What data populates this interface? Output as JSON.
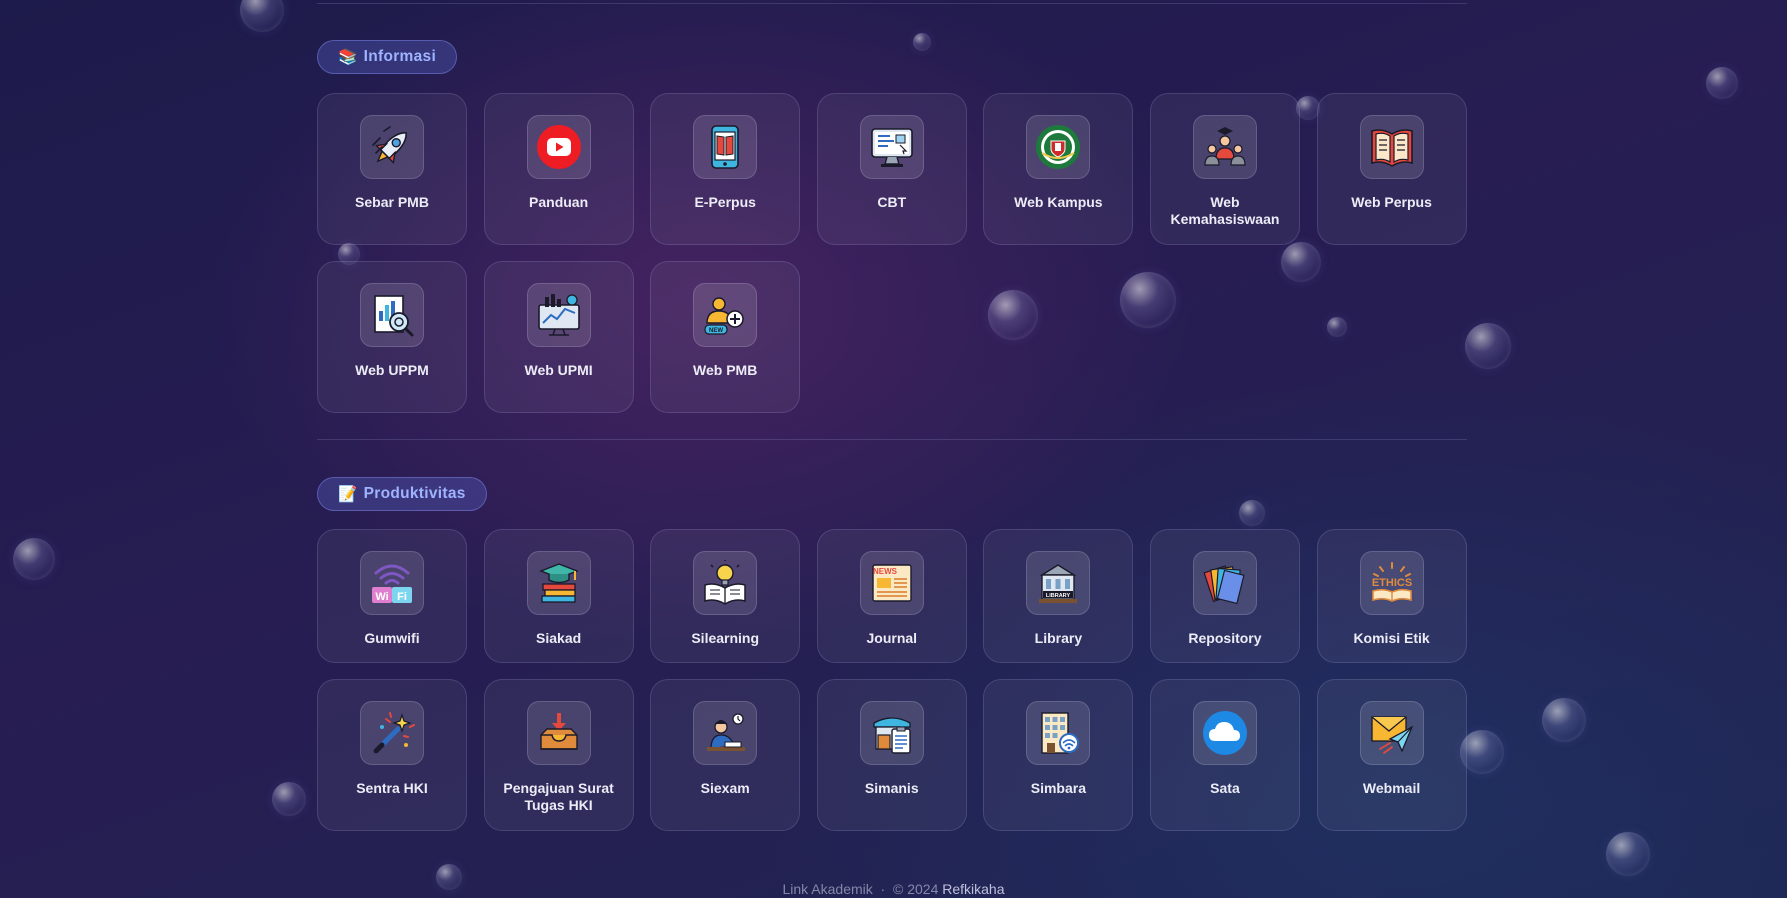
{
  "sections": [
    {
      "emoji": "📚",
      "title": "Informasi",
      "items": [
        {
          "label": "Sebar PMB",
          "icon": "rocket-icon"
        },
        {
          "label": "Panduan",
          "icon": "youtube-icon"
        },
        {
          "label": "E-Perpus",
          "icon": "ebook-icon"
        },
        {
          "label": "CBT",
          "icon": "computer-test-icon"
        },
        {
          "label": "Web Kampus",
          "icon": "campus-logo-icon"
        },
        {
          "label": "Web Kemahasiswaan",
          "icon": "students-icon"
        },
        {
          "label": "Web Perpus",
          "icon": "open-book-icon"
        },
        {
          "label": "Web UPPM",
          "icon": "research-icon"
        },
        {
          "label": "Web UPMI",
          "icon": "monitor-chart-icon"
        },
        {
          "label": "Web PMB",
          "icon": "new-user-icon"
        }
      ]
    },
    {
      "emoji": "📝",
      "title": "Produktivitas",
      "items": [
        {
          "label": "Gumwifi",
          "icon": "wifi-icon"
        },
        {
          "label": "Siakad",
          "icon": "graduation-books-icon"
        },
        {
          "label": "Silearning",
          "icon": "lightbulb-book-icon"
        },
        {
          "label": "Journal",
          "icon": "newspaper-icon"
        },
        {
          "label": "Library",
          "icon": "library-building-icon"
        },
        {
          "label": "Repository",
          "icon": "folders-icon"
        },
        {
          "label": "Komisi Etik",
          "icon": "ethics-icon"
        },
        {
          "label": "Sentra HKI",
          "icon": "magic-wand-icon"
        },
        {
          "label": "Pengajuan Surat Tugas HKI",
          "icon": "inbox-download-icon"
        },
        {
          "label": "Siexam",
          "icon": "exam-student-icon"
        },
        {
          "label": "Simanis",
          "icon": "store-clipboard-icon"
        },
        {
          "label": "Simbara",
          "icon": "hotel-building-icon"
        },
        {
          "label": "Sata",
          "icon": "cloud-icon"
        },
        {
          "label": "Webmail",
          "icon": "mail-send-icon"
        }
      ]
    }
  ],
  "footer": {
    "app": "Link Akademik",
    "separator": "·",
    "copyright": "© 2024",
    "brand": "Refkikaha"
  }
}
